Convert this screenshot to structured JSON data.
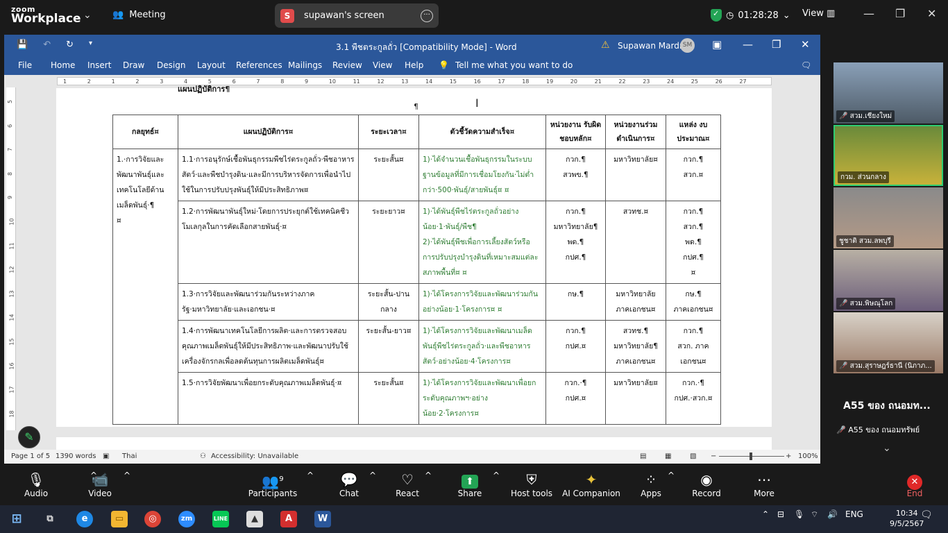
{
  "zoom": {
    "logo_line1": "zoom",
    "logo_line2": "Workplace",
    "meeting_label": "Meeting",
    "screen_badge": "S",
    "screen_name": "supawan's screen",
    "timer": "01:28:28",
    "view_label": "View"
  },
  "word": {
    "title": "3.1 พืชตระกูลถั่ว [Compatibility Mode]  -  Word",
    "user_name": "Supawan Mardmai",
    "user_initials": "SM",
    "menu": [
      "File",
      "Home",
      "Insert",
      "Draw",
      "Design",
      "Layout",
      "References",
      "Mailings",
      "Review",
      "View",
      "Help"
    ],
    "tell_me": "Tell me what you want to do",
    "ruler_ticks": [
      "1",
      "2",
      "1",
      "2",
      "3",
      "4",
      "5",
      "6",
      "7",
      "8",
      "9",
      "10",
      "11",
      "12",
      "13",
      "14",
      "15",
      "16",
      "17",
      "18",
      "19",
      "20",
      "21",
      "22",
      "23",
      "24",
      "25",
      "26",
      "27"
    ],
    "vruler_ticks": [
      "5",
      "6",
      "7",
      "8",
      "9",
      "10",
      "11",
      "12",
      "13",
      "14",
      "15",
      "16",
      "17",
      "18"
    ],
    "cut_heading": "แผนปฏิบัติการ¶",
    "status": {
      "page": "Page 1 of 5",
      "words": "1390 words",
      "language": "Thai",
      "accessibility": "Accessibility: Unavailable",
      "zoom": "100%"
    }
  },
  "table": {
    "headers": [
      "กลยุทธ์¤",
      "แผนปฏิบัติการ¤",
      "ระยะเวลา¤",
      "ตัวชี้วัดความสำเร็จ¤",
      "หน่วยงาน รับผิดชอบหลัก¤",
      "หน่วยงานร่วม ดำเนินการ¤",
      "แหล่ง งบประมาณ¤"
    ],
    "strategy": "1.·การวิจัยและพัฒนาพันธุ์และเทคโนโลยีด้านเมล็ดพันธุ์·¶ ¤",
    "rows": [
      {
        "plan": "1.1·การอนุรักษ์เชื้อพันธุกรรมพืชไร่ตระกูลถั่ว·พืชอาหารสัตว์·และพืชบำรุงดิน·และมีการบริหารจัดการเพื่อนำไปใช้ในการปรับปรุงพันธุ์ให้มีประสิทธิภาพ¤",
        "time": "ระยะสั้น¤",
        "kpi": "1)·ได้จำนวนเชื้อพันธุกรรมในระบบฐานข้อมูลที่มีการเชื่อมโยงกัน·ไม่ต่ำกว่า·500·พันธุ์/สายพันธุ์¤ ¤",
        "main": "กวก.¶ สวพข.¶",
        "co": "มหาวิทยาลัย¤",
        "budget": "กวก.¶ สวก.¤"
      },
      {
        "plan": "1.2·การพัฒนาพันธุ์ใหม่·โดยการประยุกต์ใช้เทคนิคชีวโมเลกุลในการคัดเลือกสายพันธุ์·¤",
        "time": "ระยะยาว¤",
        "kpi": "1)·ได้พันธุ์พืชไร่ตระกูลถั่วอย่างน้อย·1·พันธุ์/พืช¶ 2)·ได้พันธุ์พืชเพื่อการเลี้ยงสัตว์หรือการปรับปรุงบำรุงดินที่เหมาะสมแต่ละสภาพพื้นที่¤ ¤",
        "main": "กวก.¶ มหาวิทยาลัย¶ พด.¶ กปศ.¶",
        "co": "สวทช.¤",
        "budget": "กวก.¶ สวก.¶ พด.¶ กปศ.¶ ¤"
      },
      {
        "plan": "1.3·การวิจัยและพัฒนาร่วมกันระหว่างภาครัฐ·มหาวิทยาลัย·และเอกชน·¤",
        "time": "ระยะสั้น-ปานกลาง",
        "kpi": "1)·ได้โครงการวิจัยและพัฒนาร่วมกันอย่างน้อย·1·โครงการ¤ ¤",
        "main": "กษ.¶",
        "co": "มหาวิทยาลัย ภาคเอกชน¤",
        "budget": "กษ.¶ ภาคเอกชน¤"
      },
      {
        "plan": "1.4·การพัฒนาเทคโนโลยีการผลิต·และการตรวจสอบคุณภาพเมล็ดพันธุ์ให้มีประสิทธิภาพ·และพัฒนาปรับใช้เครื่องจักรกลเพื่อลดต้นทุนการผลิตเมล็ดพันธุ์¤",
        "time": "ระยะสั้น-ยาว¤",
        "kpi": "1)·ได้โครงการวิจัยและพัฒนาเมล็ดพันธุ์พืชไร่ตระกูลถั่ว·และพืชอาหารสัตว์·อย่างน้อย·4·โครงการ¤",
        "main": "กวก.¶ กปศ.¤",
        "co": "สวทช.¶ มหาวิทยาลัย¶ ภาคเอกชน¤",
        "budget": "กวก.¶ สวก. ภาคเอกชน¤"
      },
      {
        "plan": "1.5·การวิจัยพัฒนาเพื่อยกระดับคุณภาพเมล็ดพันธุ์·¤",
        "time": "ระยะสั้น¤",
        "kpi": "1)·ได้โครงการวิจัยและพัฒนาเพื่อยกระดับคุณภาพฯ·อย่างน้อย·2·โครงการ¤",
        "main": "กวก.·¶ กปศ.¤",
        "co": "มหาวิทยาลัย¤",
        "budget": "กวก.·¶ กปศ.·สวก.¤"
      }
    ]
  },
  "participants": [
    {
      "name": "สวม.เชียงใหม่",
      "muted": true
    },
    {
      "name": "กวม. ส่วนกลาง",
      "muted": false
    },
    {
      "name": "ชูชาติ สวม.ลพบุรี",
      "muted": false
    },
    {
      "name": "สวม.พิษณุโลก",
      "muted": true
    },
    {
      "name": "สวม.สุราษฎร์ธานี (นิภาภ...",
      "muted": true
    }
  ],
  "a55": {
    "big": "A55 ของ ถนอมท...",
    "small": "A55 ของ ถนอมทรัพย์"
  },
  "toolbar": {
    "audio": "Audio",
    "video": "Video",
    "participants": "Participants",
    "participants_count": "9",
    "chat": "Chat",
    "react": "React",
    "share": "Share",
    "host_tools": "Host tools",
    "ai_companion": "AI Companion",
    "apps": "Apps",
    "record": "Record",
    "more": "More",
    "end": "End"
  },
  "taskbar": {
    "lang": "ENG",
    "time": "10:34",
    "date": "9/5/2567"
  }
}
